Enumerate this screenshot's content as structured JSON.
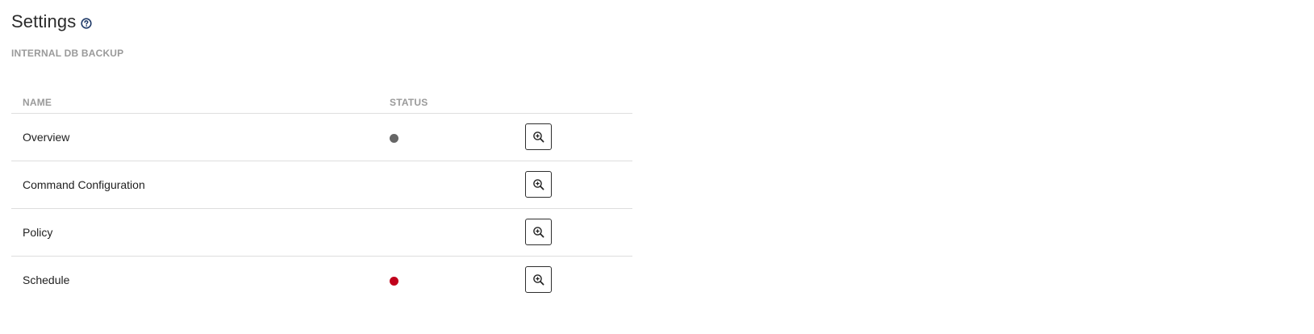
{
  "page": {
    "title": "Settings",
    "section_label": "INTERNAL DB BACKUP"
  },
  "table": {
    "columns": {
      "name": "NAME",
      "status": "STATUS"
    },
    "rows": [
      {
        "name": "Overview",
        "status": "grey",
        "status_color": "#666666",
        "action_icon": "zoom-in-icon"
      },
      {
        "name": "Command Configuration",
        "status": "",
        "status_color": "",
        "action_icon": "zoom-in-icon"
      },
      {
        "name": "Policy",
        "status": "",
        "status_color": "",
        "action_icon": "zoom-in-icon"
      },
      {
        "name": "Schedule",
        "status": "red",
        "status_color": "#c0001b",
        "action_icon": "zoom-in-icon"
      }
    ]
  },
  "colors": {
    "help_icon": "#1f3a68",
    "header_text": "#9a9a9a",
    "divider": "#dedede"
  }
}
